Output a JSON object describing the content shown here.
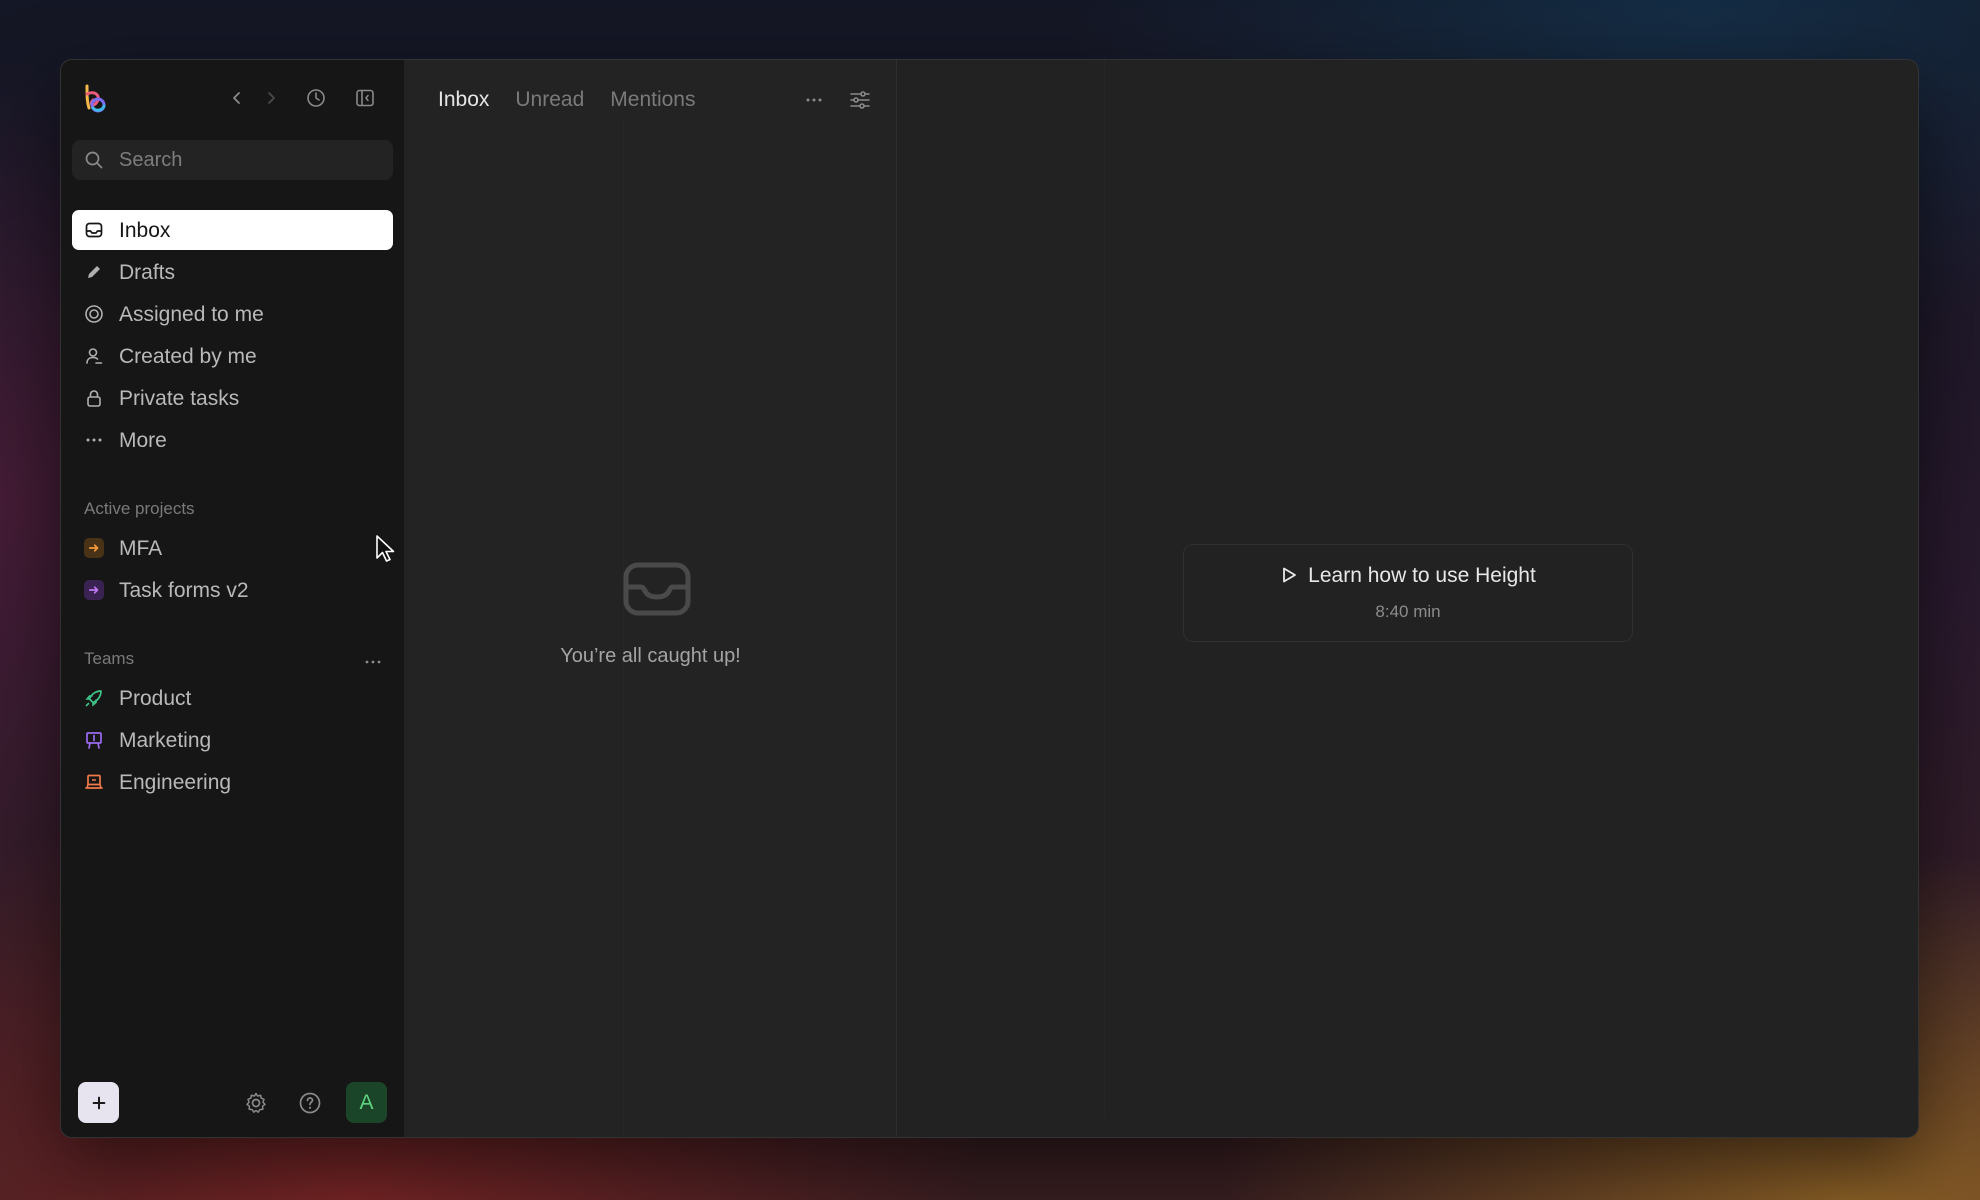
{
  "app": {
    "name": "Height"
  },
  "sidebar": {
    "search_placeholder": "Search",
    "nav": [
      {
        "label": "Inbox",
        "icon": "inbox-icon",
        "active": true
      },
      {
        "label": "Drafts",
        "icon": "pencil-icon"
      },
      {
        "label": "Assigned to me",
        "icon": "target-icon"
      },
      {
        "label": "Created by me",
        "icon": "user-icon"
      },
      {
        "label": "Private tasks",
        "icon": "lock-icon"
      },
      {
        "label": "More",
        "icon": "ellipsis-icon"
      }
    ],
    "projects_heading": "Active projects",
    "projects": [
      {
        "label": "MFA",
        "color": "#f59a3a"
      },
      {
        "label": "Task forms v2",
        "color": "#b05ce8"
      }
    ],
    "teams_heading": "Teams",
    "teams": [
      {
        "label": "Product",
        "icon": "rocket-icon",
        "color": "#3fc58a"
      },
      {
        "label": "Marketing",
        "icon": "easel-icon",
        "color": "#9b6cf0"
      },
      {
        "label": "Engineering",
        "icon": "laptop-icon",
        "color": "#f2794a"
      }
    ],
    "avatar_initial": "A"
  },
  "list": {
    "tabs": [
      {
        "label": "Inbox",
        "active": true
      },
      {
        "label": "Unread"
      },
      {
        "label": "Mentions"
      }
    ],
    "empty_message": "You’re all caught up!"
  },
  "detail": {
    "learn_title": "Learn how to use Height",
    "learn_duration": "8:40 min"
  }
}
